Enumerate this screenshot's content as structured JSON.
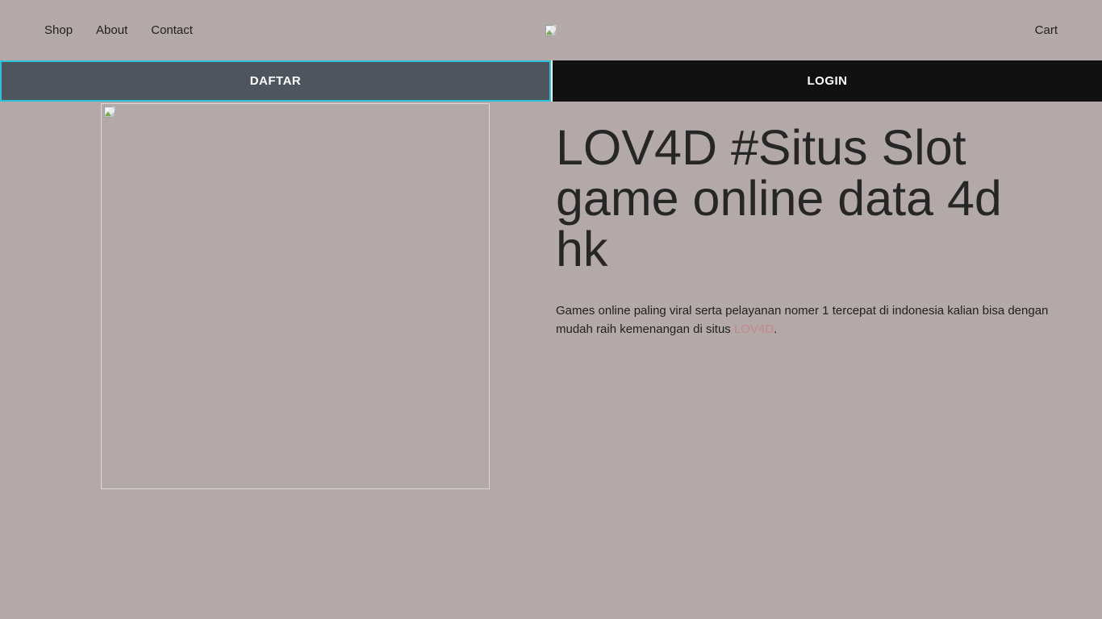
{
  "colors": {
    "background": "#b3a9a9",
    "text_dark": "#212121",
    "accent_cyan": "#2ac2d8",
    "daftar_bg": "#4e555d",
    "login_bg": "#111111",
    "button_text": "#ffffff",
    "link": "#c5868c",
    "placeholder_border": "#d8d2d2"
  },
  "nav": {
    "items": [
      {
        "label": "Shop"
      },
      {
        "label": "About"
      },
      {
        "label": "Contact"
      }
    ],
    "cart_label": "Cart",
    "logo_icon": "broken-image-icon"
  },
  "cta": {
    "daftar_label": "DAFTAR",
    "login_label": "LOGIN"
  },
  "hero": {
    "image_icon": "broken-image-icon",
    "heading": "LOV4D #Situs Slot game online data 4d hk",
    "paragraph_prefix": "Games online paling viral serta pelayanan nomer 1 tercepat di indonesia kalian bisa dengan mudah raih kemenangan di situs ",
    "link_label": "LOV4D",
    "paragraph_suffix": "."
  }
}
